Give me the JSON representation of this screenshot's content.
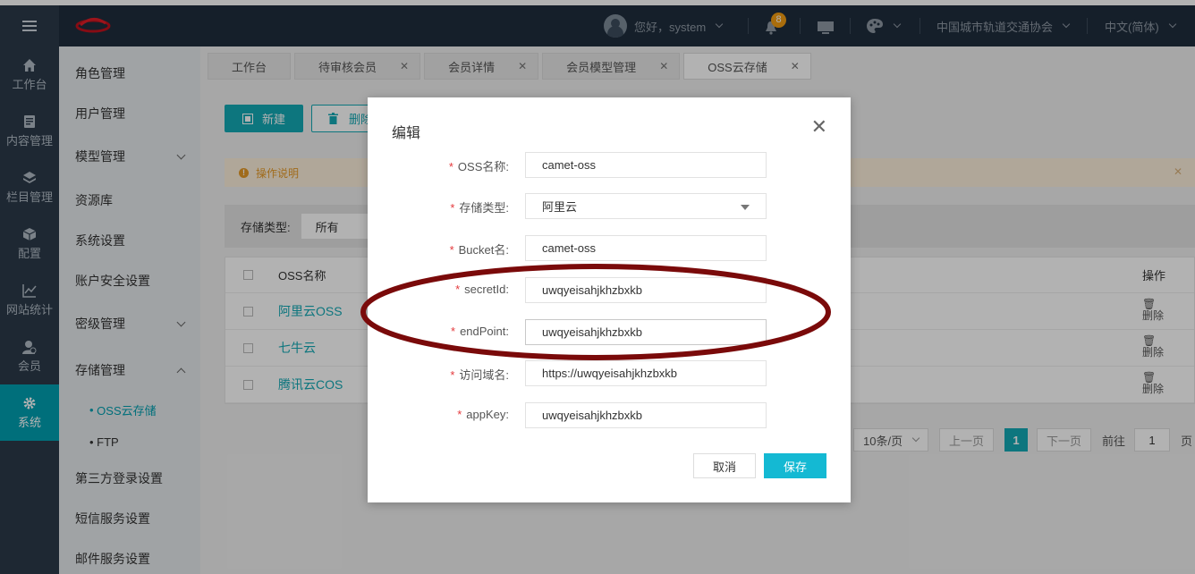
{
  "topbar": {
    "greeting": "您好，system",
    "notification_count": "8",
    "organization": "中国城市轨道交通协会",
    "language": "中文(简体)"
  },
  "rail": [
    {
      "label": "工作台",
      "icon": "home-icon"
    },
    {
      "label": "内容管理",
      "icon": "document-icon"
    },
    {
      "label": "栏目管理",
      "icon": "layers-icon"
    },
    {
      "label": "配置",
      "icon": "cube-icon"
    },
    {
      "label": "网站统计",
      "icon": "chart-icon"
    },
    {
      "label": "会员",
      "icon": "member-icon"
    },
    {
      "label": "系统",
      "icon": "gear-icon"
    }
  ],
  "submenu": {
    "role": "角色管理",
    "user": "用户管理",
    "model": "模型管理",
    "resource": "资源库",
    "system": "系统设置",
    "account": "账户安全设置",
    "secret": "密级管理",
    "storage": "存储管理",
    "oss": "OSS云存储",
    "ftp": "FTP",
    "thirdparty": "第三方登录设置",
    "sms": "短信服务设置",
    "mail": "邮件服务设置"
  },
  "tabs": [
    {
      "label": "工作台"
    },
    {
      "label": "待审核会员"
    },
    {
      "label": "会员详情"
    },
    {
      "label": "会员模型管理"
    },
    {
      "label": "OSS云存储"
    }
  ],
  "toolbar": {
    "new_label": "新建",
    "delete_label": "删除"
  },
  "notice": "操作说明",
  "filter": {
    "label": "存储类型:",
    "value": "所有"
  },
  "table": {
    "col_name": "OSS名称",
    "col_op": "操作",
    "rows": [
      {
        "name": "阿里云OSS"
      },
      {
        "name": "七牛云"
      },
      {
        "name": "腾讯云COS"
      }
    ],
    "delete_label": "删除"
  },
  "pager": {
    "page_size": "10条/页",
    "prev": "上一页",
    "current": "1",
    "next": "下一页",
    "goto_label": "前往",
    "goto_value": "1",
    "page_suffix": "页"
  },
  "modal": {
    "title": "编辑",
    "fields": [
      {
        "label": "OSS名称:",
        "value": "camet-oss"
      },
      {
        "label": "存储类型:",
        "value": "阿里云"
      },
      {
        "label": "Bucket名:",
        "value": "camet-oss"
      },
      {
        "label": "secretId:",
        "value": "uwqyeisahjkhzbxkb"
      },
      {
        "label": "endPoint:",
        "value": "uwqyeisahjkhzbxkb"
      },
      {
        "label": "访问域名:",
        "value": "https://uwqyeisahjkhzbxkb"
      },
      {
        "label": "appKey:",
        "value": "uwqyeisahjkhzbxkb"
      }
    ],
    "required_mark": "*",
    "cancel_label": "取消",
    "save_label": "保存"
  },
  "colors": {
    "accent": "#14a9b5",
    "save_button": "#14b9d3",
    "annotation": "#7a0a0a"
  }
}
